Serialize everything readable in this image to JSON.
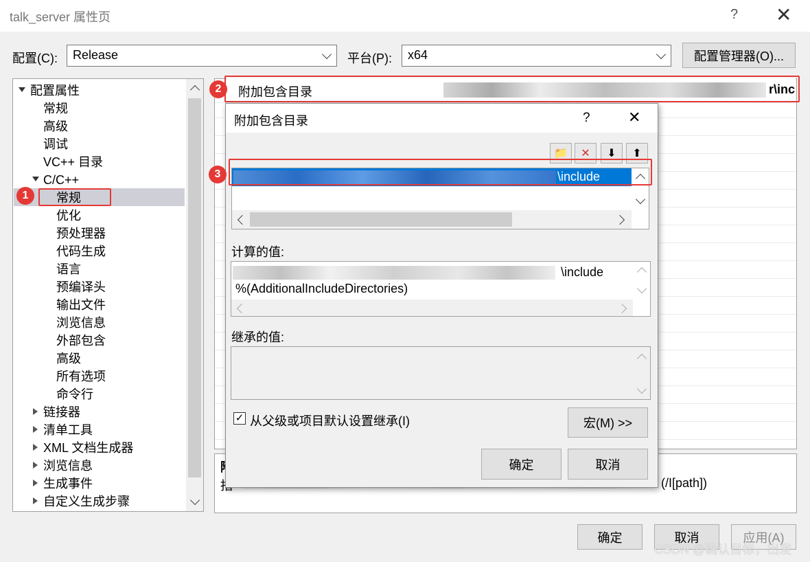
{
  "window": {
    "title": "talk_server 属性页",
    "help_label": "?",
    "close_label": "✕"
  },
  "config": {
    "label": "配置(C):",
    "value": "Release",
    "platform_label": "平台(P):",
    "platform_value": "x64",
    "manager_button": "配置管理器(O)..."
  },
  "tree": {
    "root": "配置属性",
    "items": [
      "常规",
      "高级",
      "调试",
      "VC++ 目录"
    ],
    "cpp_group": "C/C++",
    "cpp_items": [
      "常规",
      "优化",
      "预处理器",
      "代码生成",
      "语言",
      "预编译头",
      "输出文件",
      "浏览信息",
      "外部包含",
      "高级",
      "所有选项",
      "命令行"
    ],
    "collapsed": [
      "链接器",
      "清单工具",
      "XML 文档生成器",
      "浏览信息",
      "生成事件",
      "自定义生成步骤"
    ]
  },
  "grid": {
    "row_label": "附加包含目录",
    "row_value_tail": "r\\inc"
  },
  "description": {
    "title_char": "附",
    "text_char": "指",
    "text_tail": "(/I[path])"
  },
  "badges": [
    "1",
    "2",
    "3"
  ],
  "dialog": {
    "title": "附加包含目录",
    "help_label": "?",
    "close_label": "✕",
    "tool_icons": [
      "new-folder-icon",
      "delete-icon",
      "move-down-icon",
      "move-up-icon"
    ],
    "entry_tail": "\\include",
    "computed_label": "计算的值:",
    "computed_line1_tail": "\\include",
    "computed_line2": "%(AdditionalIncludeDirectories)",
    "inherited_label": "继承的值:",
    "inherit_checkbox_label": "从父级或项目默认设置继承(I)",
    "inherit_checked": true,
    "macro_button": "宏(M) >>",
    "ok_button": "确定",
    "cancel_button": "取消"
  },
  "footer": {
    "ok_button": "确定",
    "cancel_button": "取消",
    "apply_button": "应用(A)"
  },
  "watermark": "CSDN @确认目标，出发",
  "colors": {
    "selection": "#0078d7",
    "annotation_red": "#e53935",
    "tree_selection": "#cce4f7"
  }
}
